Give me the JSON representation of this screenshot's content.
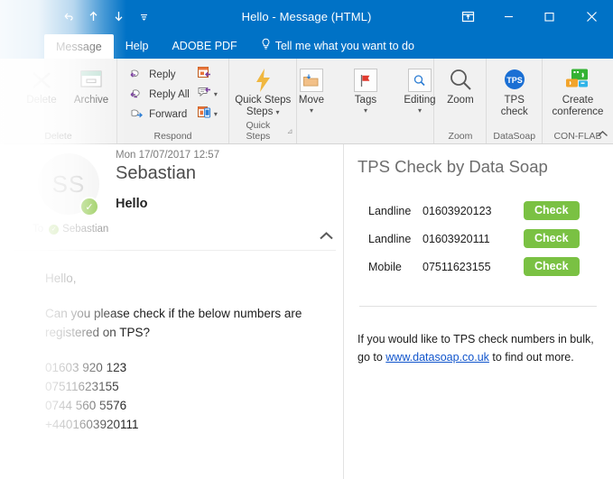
{
  "window": {
    "title": "Hello  -  Message (HTML)",
    "quick_access": [
      {
        "name": "undo-icon",
        "glyph": "↺"
      },
      {
        "name": "move-up-icon",
        "glyph": "↑"
      },
      {
        "name": "move-down-icon",
        "glyph": "↓"
      },
      {
        "name": "customize-quick-access-toolbar-icon",
        "glyph": "⩸"
      }
    ],
    "controls": {
      "ribbon_display_options": "ribbon-display-options",
      "minimize": "minimize",
      "maximize": "maximize",
      "close": "close"
    }
  },
  "tabs": [
    {
      "label": "Message",
      "active": true
    },
    {
      "label": "Help",
      "active": false
    },
    {
      "label": "ADOBE PDF",
      "active": false
    },
    {
      "label": "Tell me what you want to do",
      "active": false
    }
  ],
  "ribbon": {
    "groups": [
      {
        "label": "Delete",
        "buttons": [
          {
            "label": "Delete",
            "icon": "delete-x-icon"
          },
          {
            "label": "Archive",
            "icon": "archive-box-icon"
          }
        ]
      },
      {
        "label": "Respond",
        "has_dialog_launcher": false,
        "small_buttons": [
          {
            "label": "Reply",
            "icon": "reply-icon"
          },
          {
            "label": "Reply All",
            "icon": "reply-all-icon"
          },
          {
            "label": "Forward",
            "icon": "forward-icon"
          }
        ],
        "icon_buttons": [
          {
            "icon": "meeting-icon",
            "has_caret": false
          },
          {
            "icon": "im-reply-icon",
            "has_caret": true
          },
          {
            "icon": "more-respond-icon",
            "has_caret": true
          }
        ]
      },
      {
        "label": "Quick Steps",
        "has_dialog_launcher": true,
        "buttons": [
          {
            "label": "Quick Steps",
            "label2": "Steps",
            "icon": "lightning-bolt-icon",
            "has_caret": true
          }
        ]
      },
      {
        "label": "",
        "buttons": [
          {
            "label": "Move",
            "icon": "move-folder-icon",
            "has_caret": true
          },
          {
            "label": "Tags",
            "icon": "red-flag-icon",
            "has_caret": true
          },
          {
            "label": "Editing",
            "icon": "magnifier-editing-icon",
            "has_caret": true
          }
        ]
      },
      {
        "label": "Zoom",
        "buttons": [
          {
            "label": "Zoom",
            "icon": "zoom-magnifier-icon"
          }
        ]
      },
      {
        "label": "DataSoap",
        "buttons": [
          {
            "label": "TPS",
            "label2": "check",
            "icon": "tps-badge-icon"
          }
        ]
      },
      {
        "label": "CON-FLAB",
        "buttons": [
          {
            "label": "Create",
            "label2": "conference",
            "icon": "create-conference-icon"
          }
        ]
      }
    ],
    "collapse_label": "collapse-ribbon-icon"
  },
  "message": {
    "avatar_initials": "SS",
    "date": "Mon 17/07/2017 12:57",
    "from": "Sebastian",
    "subject": "Hello",
    "to_label": "To",
    "to_recipient": "Sebastian",
    "body": {
      "greeting": "Hello,",
      "request": "Can you please check if the below numbers are registered on TPS?",
      "numbers": [
        "01603 920 123",
        "07511623155",
        "0744 560 5576",
        "+4401603920111"
      ]
    }
  },
  "addin": {
    "title": "TPS Check by Data Soap",
    "rows": [
      {
        "type": "Landline",
        "number": "01603920123",
        "action": "Check"
      },
      {
        "type": "Landline",
        "number": "01603920111",
        "action": "Check"
      },
      {
        "type": "Mobile",
        "number": "07511623155",
        "action": "Check"
      }
    ],
    "footer_part1": "If you would like to TPS check numbers in bulk, go to ",
    "footer_link": "www.datasoap.co.uk",
    "footer_part2": " to find out more."
  },
  "colors": {
    "titlebar": "#0072c6",
    "accent_green": "#7ac143",
    "presence_green": "#76bc21",
    "link_blue": "#1155cc",
    "tps_blue": "#1a6fd4"
  }
}
